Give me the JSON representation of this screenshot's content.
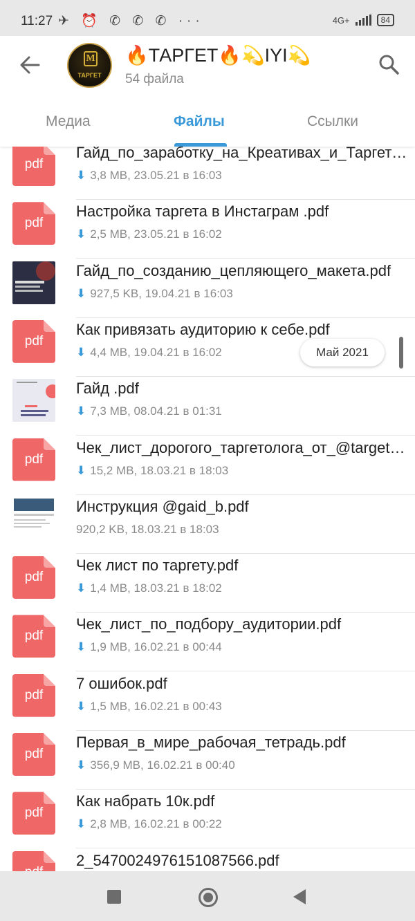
{
  "status_bar": {
    "time": "11:27",
    "icons": "✈ ⏰ ✆ ✆ ✆ ···",
    "network": "4G+",
    "battery": "84"
  },
  "header": {
    "title": "🔥ТАРГЕТ🔥💫IYI💫",
    "subtitle": "54 файла",
    "avatar_text": "ТАРГЕТ",
    "avatar_mark": "M"
  },
  "tabs": [
    {
      "label": "Медиа",
      "active": false
    },
    {
      "label": "Файлы",
      "active": true
    },
    {
      "label": "Ссылки",
      "active": false
    }
  ],
  "files": [
    {
      "name": "Гайд_по_заработку_на_Креативах_и_Таргете.pdf",
      "meta": "3,8 MB, 23.05.21 в 16:03",
      "thumb": "pdf",
      "downloaded": false
    },
    {
      "name": "Настройка таргета в Инстаграм .pdf",
      "meta": "2,5 MB, 23.05.21 в 16:02",
      "thumb": "pdf",
      "downloaded": false
    },
    {
      "name": "Гайд_по_созданию_цепляющего_макета.pdf",
      "meta": "927,5 KB, 19.04.21 в 16:03",
      "thumb": "image-dark",
      "downloaded": false
    },
    {
      "name": "Как привязать аудиторию к себе.pdf",
      "meta": "4,4 MB, 19.04.21 в 16:02",
      "thumb": "pdf",
      "downloaded": false
    },
    {
      "name": "Гайд .pdf",
      "meta": "7,3 MB, 08.04.21 в 01:31",
      "thumb": "image-light",
      "downloaded": false
    },
    {
      "name": "Чек_лист_дорогого_таргетолога_от_@target.pdf",
      "meta": "15,2 MB, 18.03.21 в 18:03",
      "thumb": "pdf",
      "downloaded": false
    },
    {
      "name": "Инструкция @gaid_b.pdf",
      "meta": "920,2 KB, 18.03.21 в 18:03",
      "thumb": "image-doc",
      "downloaded": true
    },
    {
      "name": "Чек лист по таргету.pdf",
      "meta": "1,4 MB, 18.03.21 в 18:02",
      "thumb": "pdf",
      "downloaded": false
    },
    {
      "name": "Чек_лист_по_подбору_аудитории.pdf",
      "meta": "1,9 MB, 16.02.21 в 00:44",
      "thumb": "pdf",
      "downloaded": false
    },
    {
      "name": "7 ошибок.pdf",
      "meta": "1,5 MB, 16.02.21 в 00:43",
      "thumb": "pdf",
      "downloaded": false
    },
    {
      "name": "Первая_в_мире_рабочая_тетрадь.pdf",
      "meta": "356,9 MB, 16.02.21 в 00:40",
      "thumb": "pdf",
      "downloaded": false
    },
    {
      "name": "Как набрать 10к.pdf",
      "meta": "2,8 MB, 16.02.21 в 00:22",
      "thumb": "pdf",
      "downloaded": false
    },
    {
      "name": "2_5470024976151087566.pdf",
      "meta": "",
      "thumb": "pdf",
      "downloaded": false
    }
  ],
  "pdf_label": "pdf",
  "download_icon": "⬇",
  "date_chip": "Май 2021",
  "thumb_texts": {
    "dark": "КАК СОЗДАТЬ ЦЕПЛЯЮЩИЙ МАКЕТ",
    "light_top": "ЧЕК-ЛИСТ",
    "light_main": "КАК СНИЗИТЬ ЦЕНУ ЗА КЛИК"
  },
  "colors": {
    "accent": "#3a9ad9",
    "pdf": "#ef6767"
  }
}
